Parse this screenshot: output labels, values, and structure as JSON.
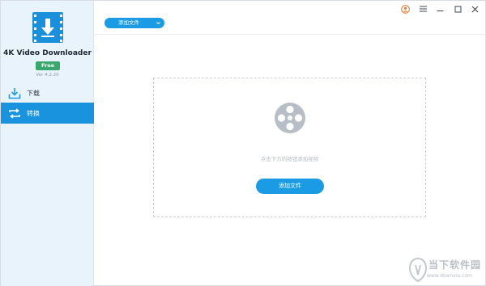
{
  "app": {
    "name": "4K Video Downloader",
    "badge": "Free",
    "version": "Ver 4.2.20"
  },
  "sidebar": {
    "items": [
      {
        "label": "下载",
        "icon": "download-icon",
        "active": false
      },
      {
        "label": "转换",
        "icon": "convert-icon",
        "active": true
      }
    ]
  },
  "toolbar": {
    "add_files_label": "添加文件",
    "window_controls": [
      "account-icon",
      "menu-icon",
      "minimize-icon",
      "maximize-icon",
      "close-icon"
    ]
  },
  "main": {
    "placeholder_icon": "film-reel-icon",
    "hint": "点击下方的按钮添加视频",
    "add_files_button": "添加文件"
  },
  "watermark": {
    "text": "当下软件园",
    "url": "www.downxia.com"
  },
  "colors": {
    "accent": "#1b9be3",
    "sidebar_bg": "#e9f3fb",
    "free_badge": "#3aa76d",
    "account_icon": "#e8732a"
  }
}
